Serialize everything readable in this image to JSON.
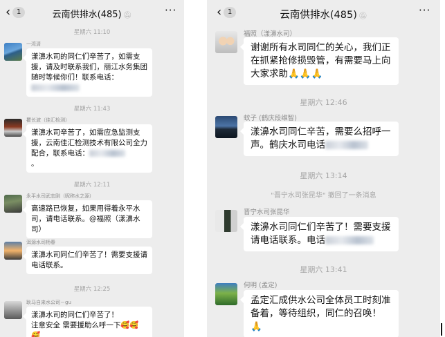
{
  "left": {
    "header": {
      "back_count": "1",
      "title": "云南供排水(485)",
      "mute_icon": "bell-muted",
      "more_icon": "ellipsis"
    },
    "timestamps": [
      "星期六 11:10",
      "星期六 11:43",
      "星期六 12:11",
      "星期六 12:25"
    ],
    "messages": [
      {
        "name": "一湾清",
        "text": "漾濞水司的同仁们辛苦了，如需支援，请及时联系我们，丽江水务集团随时等候你们！联系电话："
      },
      {
        "name": "瞿长波（佳汇检测）",
        "text": "漾濞水司辛苦了，如需应急监测支援，云南佳汇检测技术有限公司全力配合，联系电话：",
        "tail": "。"
      },
      {
        "name": "永平水司武志刚（昵称水之源）",
        "text": "高速路已恢复，如果用得着永平水司，请电话联系。@福照（漾濞水司）"
      },
      {
        "name": "洱源水司杨春",
        "text": "漾濞水司同仁们辛苦了！需要支援请电话联系。"
      },
      {
        "name": "耿马自来水公司－gu",
        "line1": "漾濞水司的同仁们辛苦了！",
        "line2": "注意安全  需要援助么呼一下🥰🥰",
        "line3": "🥰"
      }
    ]
  },
  "right": {
    "header": {
      "back_count": "1",
      "title": "云南供排水(485)",
      "mute_icon": "bell-muted",
      "more_icon": "ellipsis"
    },
    "timestamps": [
      "星期六 12:46",
      "星期六 13:14",
      "星期六 13:41"
    ],
    "recall_notice": "\"晋宁水司张昆华\" 撤回了一条消息",
    "messages": [
      {
        "name": "福照（漾濞水司）",
        "text": "谢谢所有水司同仁的关心，我们正在抓紧抢修损毁管，有需要马上向大家求助🙏🙏🙏"
      },
      {
        "name": "蚊子 (鹤庆段维智)",
        "text": "漾濞水司同仁辛苦，需要么招呼一声。鹤庆水司电话"
      },
      {
        "name": "晋宁水司张昆华",
        "text": "漾濞水司同仁们辛苦了！需要支援请电话联系。电话"
      },
      {
        "name": "何明 (孟定)",
        "text": "孟定汇成供水公司全体员工时刻准备着，等待组织，同仁的召唤！🙏"
      }
    ]
  }
}
